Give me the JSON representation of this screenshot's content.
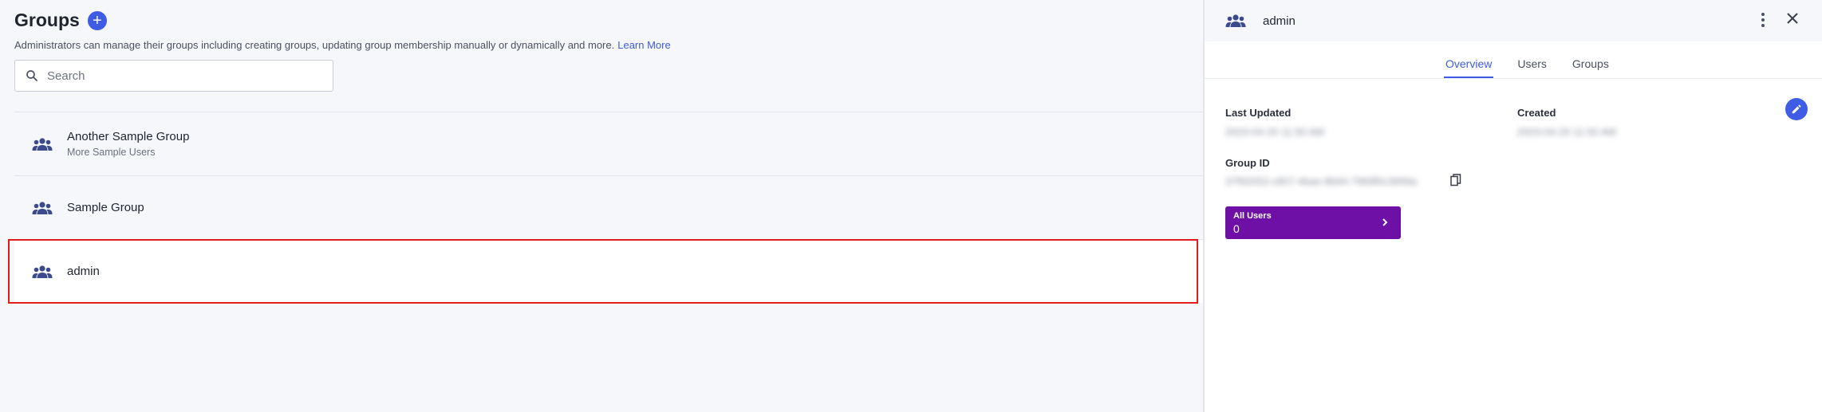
{
  "groups_page": {
    "title": "Groups",
    "add_symbol": "+",
    "description": "Administrators can manage their groups including creating groups, updating group membership manually or dynamically and more.",
    "learn_more": "Learn More",
    "search_placeholder": "Search"
  },
  "groups": [
    {
      "name": "Another Sample Group",
      "description": "More Sample Users"
    },
    {
      "name": "Sample Group",
      "description": ""
    },
    {
      "name": "admin",
      "description": "",
      "selected": true
    }
  ],
  "detail_panel": {
    "title": "admin",
    "tabs": [
      "Overview",
      "Users",
      "Groups"
    ],
    "active_tab": "Overview",
    "last_updated_label": "Last Updated",
    "last_updated_value": "2023-04-20 11:50 AM",
    "created_label": "Created",
    "created_value": "2023-04-20 11:50 AM",
    "group_id_label": "Group ID",
    "group_id_value": "37f92052-c807-4bae-8b94-7969f0c3999a",
    "all_users_label": "All Users",
    "all_users_count": "0"
  },
  "colors": {
    "accent": "#3e5ce4",
    "all_users_tile": "#6e10a6",
    "selection_outline": "#e11c1c",
    "group_icon": "#3a4a8a"
  },
  "icons": {
    "add": "plus-icon",
    "search": "search-icon",
    "group": "group-icon",
    "menu": "kebab-icon",
    "close": "close-icon",
    "edit": "pencil-icon",
    "copy": "copy-icon",
    "chevron": "chevron-right-icon"
  }
}
